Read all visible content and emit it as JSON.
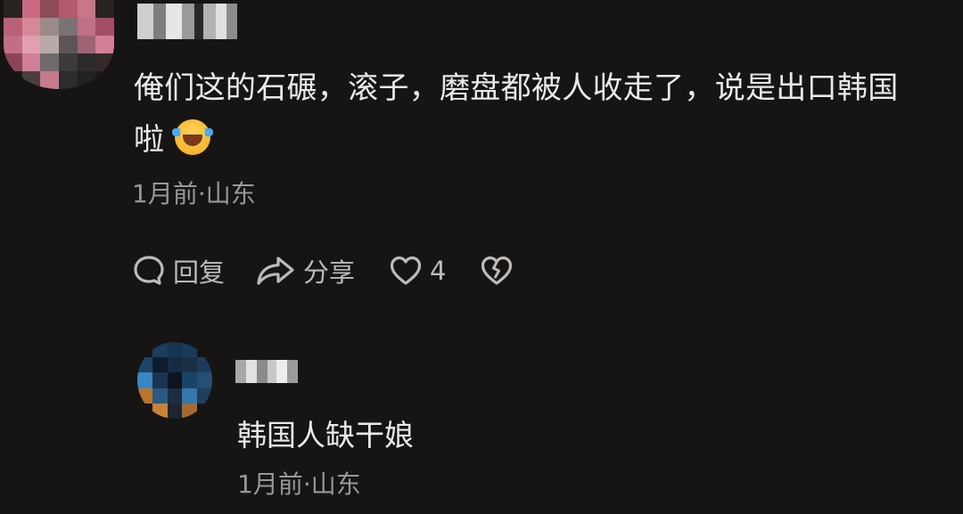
{
  "comment": {
    "text_line1": "俺们这的石碾，滚子，磨盘都被人收走了，说是出口韩国",
    "text_line2": "啦",
    "emoji": "laughing-crying-emoji",
    "meta": "1月前·山东",
    "actions": {
      "reply_label": "回复",
      "share_label": "分享",
      "like_count": "4"
    }
  },
  "reply": {
    "text": "韩国人缺干娘",
    "meta": "1月前·山东"
  },
  "icons": {
    "reply": "comment-bubble-icon",
    "share": "share-arrow-icon",
    "like": "heart-icon",
    "dislike": "broken-heart-icon"
  },
  "colors": {
    "background": "#171514",
    "text": "#ebe9e7",
    "meta": "#9a9794",
    "action": "#bdbab7"
  }
}
